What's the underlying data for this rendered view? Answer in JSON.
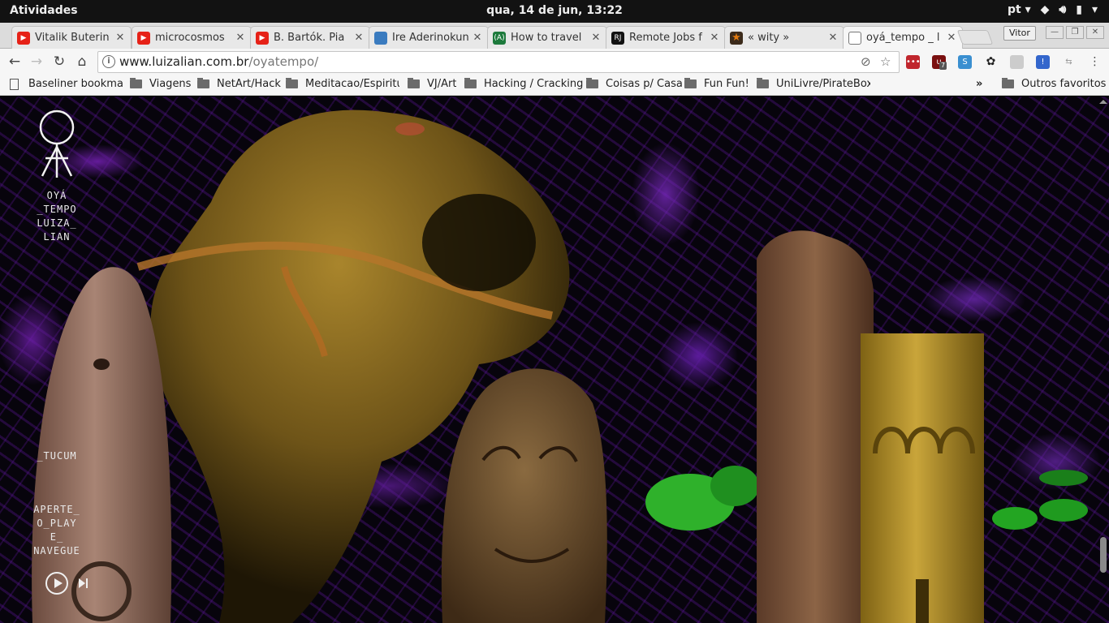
{
  "topbar": {
    "activities": "Atividades",
    "clock": "qua, 14 de jun, 13:22",
    "lang": "pt"
  },
  "tabs": [
    {
      "label": "Vitalik Buterin",
      "icon": "youtube-icon",
      "color": "#e62117"
    },
    {
      "label": "microcosmos",
      "icon": "youtube-icon",
      "color": "#e62117"
    },
    {
      "label": "B. Bartók. Pia",
      "icon": "youtube-icon",
      "color": "#e62117"
    },
    {
      "label": "Ire Aderinokun",
      "icon": "avatar-icon",
      "color": "#3a7bbf"
    },
    {
      "label": "How to travel",
      "icon": "site-icon",
      "color": "#1d7a3c"
    },
    {
      "label": "Remote Jobs f",
      "icon": "site-icon",
      "color": "#111111"
    },
    {
      "label": "« wity »",
      "icon": "star-icon",
      "color": "#cc6a10"
    },
    {
      "label": "oyá_tempo _ l",
      "icon": "page-icon",
      "color": "#ffffff"
    }
  ],
  "profile": "Vitor",
  "address": {
    "domain": "www.luizalian.com.br",
    "path": "/oyatempo/"
  },
  "bookmarks": [
    {
      "label": "Baseliner bookmar",
      "type": "page"
    },
    {
      "label": "Viagens",
      "type": "folder"
    },
    {
      "label": "NetArt/Hack",
      "type": "folder"
    },
    {
      "label": "Meditacao/Espiritu",
      "type": "folder"
    },
    {
      "label": "VJ/Art",
      "type": "folder"
    },
    {
      "label": "Hacking / Cracking",
      "type": "folder"
    },
    {
      "label": "Coisas p/ Casa",
      "type": "folder"
    },
    {
      "label": "Fun Fun!",
      "type": "folder"
    },
    {
      "label": "UniLivre/PirateBox/",
      "type": "folder"
    },
    {
      "label": "»",
      "type": "overflow"
    },
    {
      "label": "Outros favoritos",
      "type": "folder"
    }
  ],
  "extensions": {
    "ublock_badge": "7"
  },
  "site": {
    "title": "OYÁ\n_TEMPO\nLUIZA_\nLIAN",
    "link": "_TUCUM",
    "instruction": "APERTE_\nO_PLAY\nE_\nNAVEGUE"
  }
}
